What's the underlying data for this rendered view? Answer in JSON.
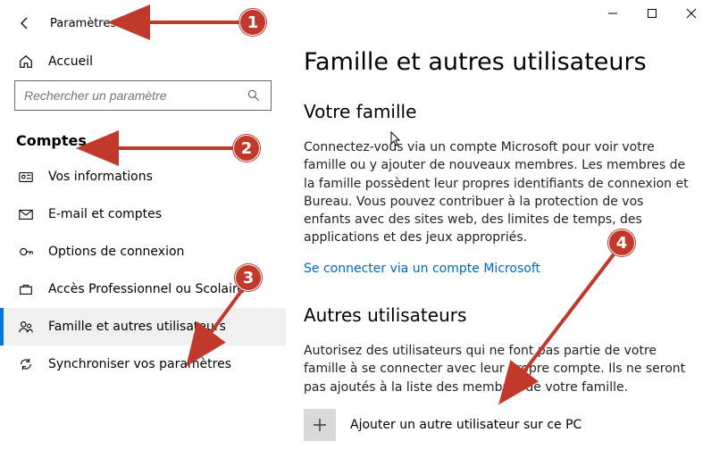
{
  "window": {
    "title": "Paramètres"
  },
  "sidebar": {
    "home": "Accueil",
    "search_placeholder": "Rechercher un paramètre",
    "section": "Comptes",
    "items": [
      {
        "label": "Vos informations"
      },
      {
        "label": "E-mail et comptes"
      },
      {
        "label": "Options de connexion"
      },
      {
        "label": "Accès Professionnel ou Scolaire"
      },
      {
        "label": "Famille et autres utilisateurs"
      },
      {
        "label": "Synchroniser vos paramètres"
      }
    ]
  },
  "main": {
    "heading": "Famille et autres utilisateurs",
    "family": {
      "title": "Votre famille",
      "body": "Connectez-vous via un compte Microsoft pour voir votre famille ou y ajouter de nouveaux membres. Les membres de la famille possèdent leur propres identifiants de connexion et Bureau. Vous pouvez contribuer à la protection de vos enfants avec des sites web, des limites de temps, des applications et des jeux appropriés.",
      "link": "Se connecter via un compte Microsoft"
    },
    "others": {
      "title": "Autres utilisateurs",
      "body": "Autorisez des utilisateurs qui ne font pas partie de votre famille à se connecter avec leur propre compte. Ils ne seront pas ajoutés à la liste des membres de votre famille.",
      "add_label": "Ajouter un autre utilisateur sur ce PC"
    }
  },
  "callouts": {
    "c1": "1",
    "c2": "2",
    "c3": "3",
    "c4": "4"
  }
}
